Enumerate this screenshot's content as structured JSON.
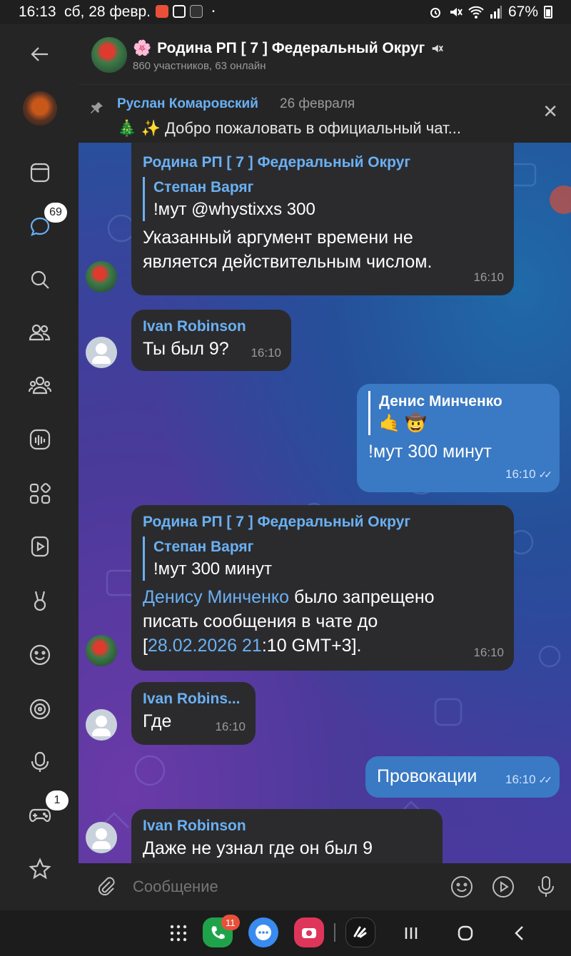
{
  "status_bar": {
    "time": "16:13",
    "date": "сб, 28 февр.",
    "battery": "67%"
  },
  "rail": {
    "chats_badge": "69",
    "games_badge": "1"
  },
  "header": {
    "title": "Родина РП [ 7 ] Федеральный Округ",
    "title_emoji": "🌸",
    "subtitle": "860 участников, 63 онлайн"
  },
  "pinned": {
    "author": "Руслан Комаровский",
    "date": "26 февраля",
    "text": "🎄 ✨ Добро пожаловать в официальный чат..."
  },
  "messages": [
    {
      "sender": "Родина РП [ 7 ] Федеральный Округ",
      "quote_name": "Степан Варяг",
      "quote_text": "!мут @whystixxs 300",
      "text": "Указанный аргумент времени не является действительным числом.",
      "time": "16:10"
    },
    {
      "sender": "Ivan Robinson",
      "text": "Ты был 9?",
      "time": "16:10"
    },
    {
      "quote_name": "Денис Минченко",
      "quote_text": "🤙 🤠",
      "text": "!мут 300 минут",
      "time": "16:10"
    },
    {
      "sender": "Родина РП [ 7 ] Федеральный Округ",
      "quote_name": "Степан Варяг",
      "quote_text": "!мут 300 минут",
      "link_name": "Денису Минченко",
      "text_a": " было запрещено писать сообщения в чате до ",
      "bracket_open": "[",
      "link_date": "28.02.2026 21",
      "text_b": ":10 GMT+3].",
      "time": "16:10"
    },
    {
      "sender": "Ivan Robins...",
      "text": "Где",
      "time": "16:10"
    },
    {
      "text": "Провокации",
      "time": "16:10"
    },
    {
      "sender": "Ivan Robinson",
      "text": "Даже не узнал где он был 9"
    }
  ],
  "composer": {
    "placeholder": "Сообщение"
  },
  "navbar": {
    "phone_badge": "11"
  }
}
